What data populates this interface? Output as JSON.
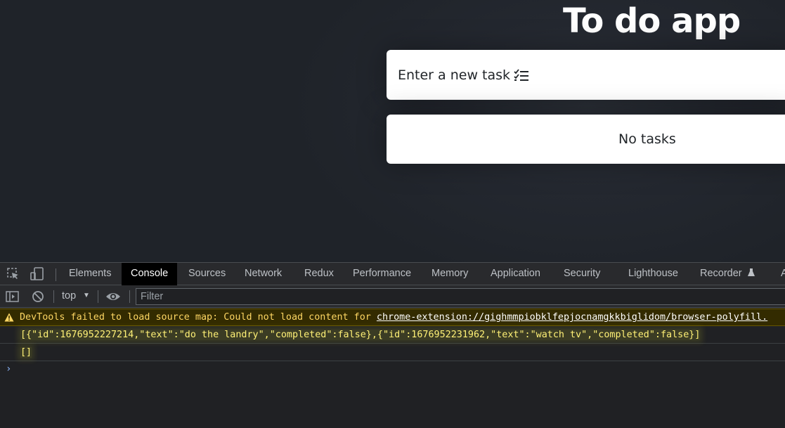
{
  "app": {
    "title": "To do app",
    "input_placeholder": "Enter a new task",
    "empty_message": "No tasks"
  },
  "devtools": {
    "tabs": [
      "Elements",
      "Console",
      "Sources",
      "Network",
      "Redux",
      "Performance",
      "Memory",
      "Application",
      "Security",
      "Lighthouse",
      "Recorder",
      "A"
    ],
    "active_tab": "Console",
    "context": "top",
    "filter_placeholder": "Filter",
    "console": {
      "warning_prefix": "DevTools failed to load source map: Could not load content for ",
      "warning_link": "chrome-extension://gighmmpiobklfepjocnamgkkbiglidom/browser-polyfill.",
      "log_1": "[{\"id\":1676952227214,\"text\":\"do the landry\",\"completed\":false},{\"id\":1676952231962,\"text\":\"watch tv\",\"completed\":false}]",
      "log_2": "[]"
    }
  },
  "icons": {
    "inspect": "inspect-element-icon",
    "device": "device-toolbar-icon",
    "sidebar": "console-sidebar-icon",
    "clear": "clear-console-icon",
    "eye": "live-expression-icon",
    "warning": "warning-icon",
    "checklist": "checklist-icon",
    "flask": "flask-icon"
  },
  "colors": {
    "app_bg": "#242830",
    "devtools_bg": "#202124",
    "warning_text": "#fdd663",
    "warning_bg": "#332b00",
    "active_tab_bg": "#000000"
  }
}
